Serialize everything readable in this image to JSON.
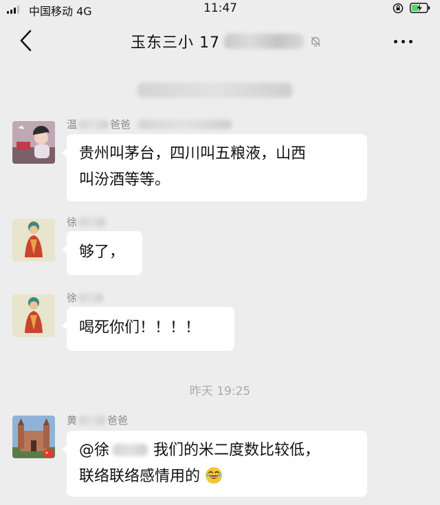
{
  "status_bar": {
    "carrier": "中国移动 4G",
    "time": "11:47"
  },
  "header": {
    "title": "玉东三小 17"
  },
  "timestamp": "昨天 19:25",
  "messages": [
    {
      "sender_prefix": "温",
      "sender_suffix": "爸爸",
      "text_line1": "贵州叫茅台，四川叫五粮液，山西",
      "text_line2": "叫汾酒等等。"
    },
    {
      "sender_prefix": "徐",
      "text_line1": "够了，"
    },
    {
      "sender_prefix": "徐",
      "text_line1": "喝死你们！！！！"
    },
    {
      "sender_prefix": "黄",
      "sender_suffix": "爸爸",
      "mention": "@徐",
      "text_line1_rest": "我们的米二度数比较低，",
      "text_line2": "联络联络感情用的"
    }
  ],
  "colors": {
    "background": "#ededed",
    "bubble": "#ffffff",
    "sender": "#888888",
    "timestamp": "#aaaaaa"
  },
  "icons": [
    "signal-icon",
    "lock-rotation-icon",
    "battery-charging-icon",
    "back-chevron-icon",
    "mute-bell-icon",
    "more-icon",
    "laughing-emoji-icon"
  ]
}
